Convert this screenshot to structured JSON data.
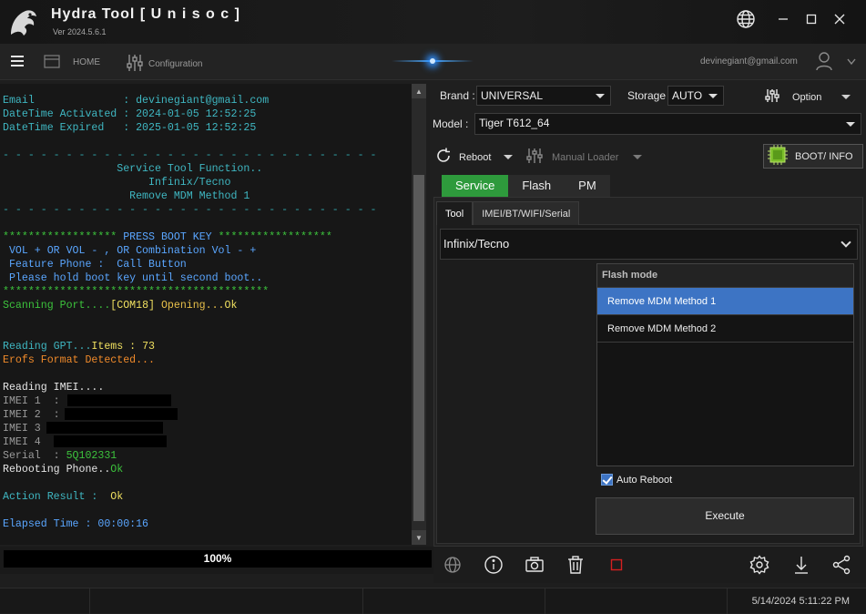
{
  "app": {
    "title": "Hydra Tool  [ U n i s o c ]",
    "version": "Ver 2024.5.6.1"
  },
  "nav": {
    "home": "HOME",
    "configuration": "Configuration",
    "user_email": "devinegiant@gmail.com"
  },
  "console": {
    "lines": [
      {
        "segs": [
          {
            "t": "Email              : devinegiant@gmail.com",
            "c": "#3fb7c2"
          }
        ]
      },
      {
        "segs": [
          {
            "t": "DateTime Activated : 2024-01-05 12:52:25",
            "c": "#3fb7c2"
          }
        ]
      },
      {
        "segs": [
          {
            "t": "DateTime Expired   : 2025-01-05 12:52:25",
            "c": "#3fb7c2"
          }
        ]
      },
      {
        "segs": [
          {
            "t": "",
            "c": "#3fb7c2"
          }
        ]
      },
      {
        "segs": [
          {
            "t": "- - - - - - - - - - - - - - - - - - - - - - - - - - - - - -",
            "c": "#2fa3a8"
          }
        ]
      },
      {
        "segs": [
          {
            "t": "                  Service Tool Function..",
            "c": "#3fb7c2"
          }
        ]
      },
      {
        "segs": [
          {
            "t": "                       Infinix/Tecno",
            "c": "#3fb7c2"
          }
        ]
      },
      {
        "segs": [
          {
            "t": "                    Remove MDM Method 1",
            "c": "#3fb7c2"
          }
        ]
      },
      {
        "segs": [
          {
            "t": "- - - - - - - - - - - - - - - - - - - - - - - - - - - - - -",
            "c": "#2fa3a8"
          }
        ]
      },
      {
        "segs": [
          {
            "t": "",
            "c": "#3fb7c2"
          }
        ]
      },
      {
        "segs": [
          {
            "t": "****************** ",
            "c": "#3cc23c"
          },
          {
            "t": "PRESS BOOT KEY",
            "c": "#5aa6ff"
          },
          {
            "t": " ******************",
            "c": "#3cc23c"
          }
        ]
      },
      {
        "segs": [
          {
            "t": " VOL + OR VOL - , OR Combination Vol - +",
            "c": "#5aa6ff"
          }
        ]
      },
      {
        "segs": [
          {
            "t": " Feature Phone :  Call Button",
            "c": "#5aa6ff"
          }
        ]
      },
      {
        "segs": [
          {
            "t": " Please hold boot key until second boot..",
            "c": "#5aa6ff"
          }
        ]
      },
      {
        "segs": [
          {
            "t": "******************************************",
            "c": "#3cc23c"
          }
        ]
      },
      {
        "segs": [
          {
            "t": "Scanning Port....",
            "c": "#3cc23c"
          },
          {
            "t": "[COM18]",
            "c": "#f0e060"
          },
          {
            "t": " Opening...",
            "c": "#e8c04a"
          },
          {
            "t": "Ok",
            "c": "#f0e060"
          }
        ]
      },
      {
        "segs": [
          {
            "t": "",
            "c": "#3fb7c2"
          }
        ]
      },
      {
        "segs": [
          {
            "t": "",
            "c": "#3fb7c2"
          }
        ]
      },
      {
        "segs": [
          {
            "t": "Reading GPT...",
            "c": "#3fb7c2"
          },
          {
            "t": "Items : 73",
            "c": "#f0e060"
          }
        ]
      },
      {
        "segs": [
          {
            "t": "Erofs Format Detected...",
            "c": "#f08a2a"
          }
        ]
      },
      {
        "segs": [
          {
            "t": "",
            "c": "#3fb7c2"
          }
        ]
      },
      {
        "segs": [
          {
            "t": "Reading IMEI....",
            "c": "#e6e6e6"
          }
        ]
      },
      {
        "segs": [
          {
            "t": "IMEI 1  :",
            "c": "#9a9a9a"
          }
        ],
        "redact": [
          8,
          114
        ]
      },
      {
        "segs": [
          {
            "t": "IMEI 2  :",
            "c": "#9a9a9a"
          }
        ],
        "redact": [
          5,
          124
        ]
      },
      {
        "segs": [
          {
            "t": "IMEI 3",
            "c": "#9a9a9a"
          }
        ],
        "redact": [
          6,
          128
        ]
      },
      {
        "segs": [
          {
            "t": "IMEI 4",
            "c": "#9a9a9a"
          }
        ],
        "redact": [
          14,
          124
        ]
      },
      {
        "segs": [
          {
            "t": "Serial  : ",
            "c": "#9a9a9a"
          },
          {
            "t": "5Q102331",
            "c": "#3cc23c"
          }
        ]
      },
      {
        "segs": [
          {
            "t": "Rebooting Phone..",
            "c": "#e6e6e6"
          },
          {
            "t": "Ok",
            "c": "#3cc23c"
          }
        ]
      },
      {
        "segs": [
          {
            "t": "",
            "c": "#3fb7c2"
          }
        ]
      },
      {
        "segs": [
          {
            "t": "Action Result :  ",
            "c": "#3fb7c2"
          },
          {
            "t": "Ok",
            "c": "#f0e060"
          }
        ]
      },
      {
        "segs": [
          {
            "t": "",
            "c": "#3fb7c2"
          }
        ]
      },
      {
        "segs": [
          {
            "t": "Elapsed Time : 00:00:16",
            "c": "#5aa6ff"
          }
        ]
      }
    ]
  },
  "progress": {
    "label": "100%",
    "value": 1.0
  },
  "panel": {
    "brand_label": "Brand :",
    "brand_value": "UNIVERSAL",
    "storage_label": "Storage",
    "storage_value": "AUTO",
    "option_label": "Option",
    "model_label": "Model :",
    "model_value": "Tiger T612_64",
    "reboot_label": "Reboot",
    "manual_loader_label": "Manual Loader",
    "boot_info_label": "BOOT/ INFO",
    "main_tabs": [
      "Service",
      "Flash",
      "PM"
    ],
    "sub_tabs": [
      "Tool",
      "IMEI/BT/WIFI/Serial"
    ],
    "vendor_value": "Infinix/Tecno",
    "method_header": "Flash mode",
    "methods": [
      "Remove MDM Method 1",
      "Remove MDM Method 2"
    ],
    "auto_reboot_label": "Auto Reboot",
    "execute_label": "Execute"
  },
  "status": {
    "datetime": "5/14/2024 5:11:22 PM"
  },
  "colors": {
    "accent_green": "#2e9a3c",
    "selection_blue": "#3d74c4",
    "console_bg": "#171717"
  }
}
